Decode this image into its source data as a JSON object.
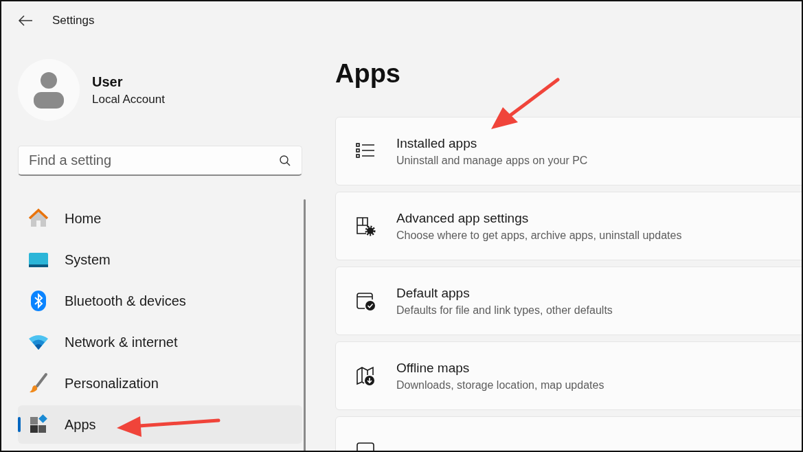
{
  "window": {
    "title": "Settings"
  },
  "account": {
    "name": "User",
    "type": "Local Account"
  },
  "search": {
    "placeholder": "Find a setting"
  },
  "sidebar": {
    "items": [
      {
        "kind": "home",
        "label": "Home",
        "selected": false
      },
      {
        "kind": "system",
        "label": "System",
        "selected": false
      },
      {
        "kind": "bluetooth",
        "label": "Bluetooth & devices",
        "selected": false
      },
      {
        "kind": "network",
        "label": "Network & internet",
        "selected": false
      },
      {
        "kind": "personalization",
        "label": "Personalization",
        "selected": false
      },
      {
        "kind": "apps",
        "label": "Apps",
        "selected": true
      }
    ]
  },
  "page": {
    "title": "Apps"
  },
  "cards": [
    {
      "kind": "list",
      "title": "Installed apps",
      "description": "Uninstall and manage apps on your PC"
    },
    {
      "kind": "advanced",
      "title": "Advanced app settings",
      "description": "Choose where to get apps, archive apps, uninstall updates"
    },
    {
      "kind": "default",
      "title": "Default apps",
      "description": "Defaults for file and link types, other defaults"
    },
    {
      "kind": "map",
      "title": "Offline maps",
      "description": "Downloads, storage location, map updates"
    },
    {
      "kind": "web"
    }
  ]
}
